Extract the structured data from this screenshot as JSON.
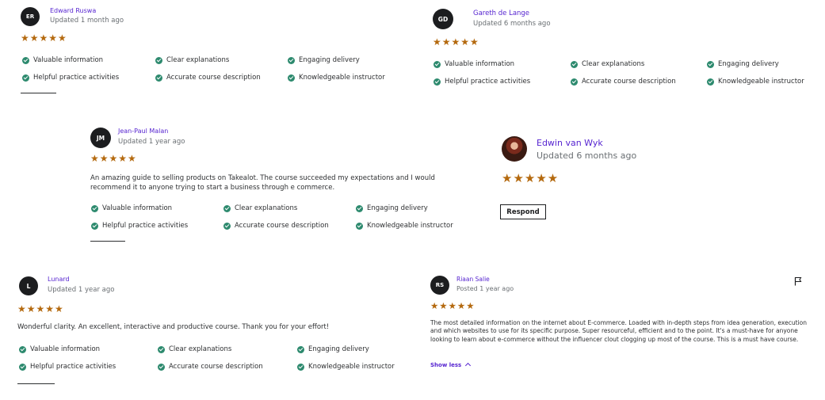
{
  "features": {
    "valuable": "Valuable information",
    "clear": "Clear explanations",
    "engaging": "Engaging delivery",
    "helpful": "Helpful practice activities",
    "accurate": "Accurate course description",
    "knowledgeable": "Knowledgeable instructor"
  },
  "stars": "★★★★★",
  "colors": {
    "accent": "#5624d0",
    "star": "#b4690e",
    "check": "#2d8a6e",
    "avatar": "#1c1d1f"
  },
  "reviews": [
    {
      "initials": "ER",
      "name": "Edward Ruswa",
      "meta": "Updated 1 month ago",
      "rating": 5
    },
    {
      "initials": "GD",
      "name": "Gareth de Lange",
      "meta": "Updated 6 months ago",
      "rating": 5
    },
    {
      "initials": "JM",
      "name": "Jean-Paul Malan",
      "meta": "Updated 1 year ago",
      "rating": 5,
      "text": "An amazing guide to selling products on Takealot. The course succeeded my expectations and I would recommend it to anyone trying to start a business through e commerce."
    },
    {
      "initials": "",
      "name": "Edwin van Wyk",
      "meta": "Updated 6 months ago",
      "rating": 5,
      "respond_label": "Respond"
    },
    {
      "initials": "L",
      "name": "Lunard",
      "meta": "Updated 1 year ago",
      "rating": 5,
      "text": "Wonderful clarity. An excellent, interactive and productive course. Thank you for your effort!"
    },
    {
      "initials": "RS",
      "name": "Riaan Salie",
      "meta": "Posted 1 year ago",
      "rating": 5,
      "text": "The most detailed information on the internet about E-commerce. Loaded with in-depth steps from idea generation, execution and which websites to use for its specific purpose. Super resourceful, efficient and to the point. It's a must-have for anyone looking to learn about e-commerce without the influencer clout clogging up most of the course. This is a must have course.",
      "show_less_label": "Show less"
    }
  ]
}
